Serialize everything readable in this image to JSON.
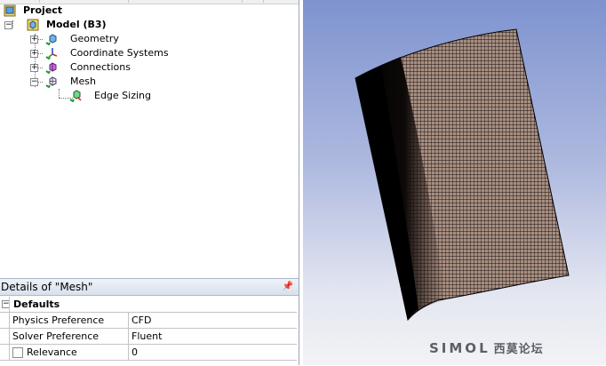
{
  "tree": {
    "project": "Project",
    "model": "Model (B3)",
    "items": [
      {
        "label": "Geometry",
        "icon": "geometry-icon"
      },
      {
        "label": "Coordinate Systems",
        "icon": "coordinate-systems-icon"
      },
      {
        "label": "Connections",
        "icon": "connections-icon"
      },
      {
        "label": "Mesh",
        "icon": "mesh-icon"
      }
    ],
    "child": {
      "label": "Edge Sizing",
      "icon": "edge-sizing-icon"
    }
  },
  "details": {
    "title": "Details of \"Mesh\"",
    "section": "Defaults",
    "rows": [
      {
        "name": "Physics Preference",
        "value": "CFD"
      },
      {
        "name": "Solver Preference",
        "value": "Fluent"
      },
      {
        "name": "Relevance",
        "value": "0"
      }
    ]
  },
  "watermark": {
    "latin": "SIMOL",
    "cn": "西莫论坛"
  },
  "colors": {
    "mesh": "#000000",
    "viewport_top": "#7e93cf",
    "viewport_bottom": "#f3f3f6",
    "check": "#2a9a2a"
  }
}
